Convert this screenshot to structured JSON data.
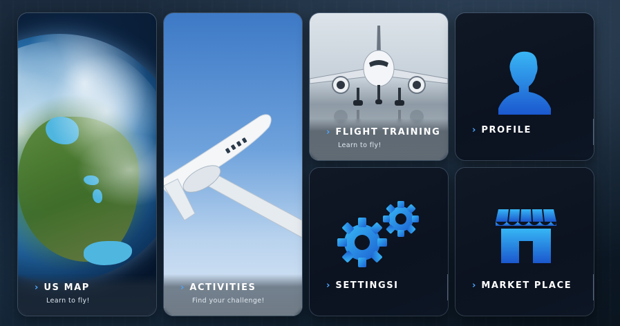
{
  "tiles": {
    "us_map": {
      "title": "US MAP",
      "subtitle": "Learn to fly!"
    },
    "activities": {
      "title": "ACTIVITIES",
      "subtitle": "Find your challenge!"
    },
    "flight_training": {
      "title": "FLIGHT TRAINING",
      "subtitle": "Learn to fly!"
    },
    "profile": {
      "title": "PROFILE"
    },
    "settings": {
      "title": "SETTINGSI"
    },
    "market_place": {
      "title": "MARKET PLACE"
    }
  },
  "chevron_glyph": "›",
  "icons": {
    "profile": "person-silhouette-icon",
    "settings": "gears-icon",
    "market_place": "storefront-icon",
    "chevron": "chevron-right-icon"
  },
  "colors": {
    "accent": "#4da6ff",
    "icon_blue_light": "#35b4f4",
    "icon_blue_dark": "#1c5fd0",
    "tile_dark": "#0b1220",
    "border": "#8caac8"
  }
}
